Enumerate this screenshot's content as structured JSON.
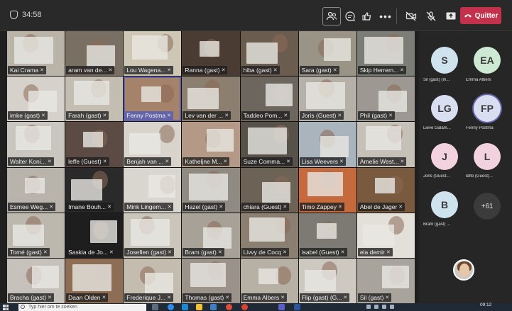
{
  "meeting": {
    "timer": "34:58",
    "leave_label": "Quitter"
  },
  "toolbar_icons": [
    "people-icon",
    "chat-icon",
    "reactions-icon",
    "more-icon",
    "camera-off-icon",
    "mic-off-icon",
    "share-icon",
    "phone-icon"
  ],
  "participants": [
    {
      "name": "Kai Crama",
      "bg": "#b9b3a8"
    },
    {
      "name": "aram van de...",
      "bg": "#7a6f63"
    },
    {
      "name": "Lou Wagena...",
      "bg": "#cfc7b6"
    },
    {
      "name": "Ranna (gast)",
      "bg": "#4a3b33"
    },
    {
      "name": "hiba (gast)",
      "bg": "#6b5c50"
    },
    {
      "name": "Sara (gast)",
      "bg": "#9a9487"
    },
    {
      "name": "Skip Herrem...",
      "bg": "#7d7d78"
    },
    {
      "name": "imke (gast)",
      "bg": "#d6d2cb"
    },
    {
      "name": "Farah (gast)",
      "bg": "#c3bdb2"
    },
    {
      "name": "Fenny Postma",
      "bg": "#a5826a",
      "active": true
    },
    {
      "name": "Lev van der ...",
      "bg": "#8c7f70"
    },
    {
      "name": "Taddeo Pom...",
      "bg": "#6c665f"
    },
    {
      "name": "Joris (Guest)",
      "bg": "#b6b1a8"
    },
    {
      "name": "Phil (gast)",
      "bg": "#9d9992"
    },
    {
      "name": "Walter Koni...",
      "bg": "#c9c6bf"
    },
    {
      "name": "leffe (Guest)",
      "bg": "#5c4a45"
    },
    {
      "name": "Benjah van ...",
      "bg": "#d8d4cc"
    },
    {
      "name": "Katheljne M...",
      "bg": "#b49a86"
    },
    {
      "name": "Suze Comma...",
      "bg": "#575249"
    },
    {
      "name": "Lisa Weevers",
      "bg": "#a9b4bd"
    },
    {
      "name": "Amelie West...",
      "bg": "#c5c1b9"
    },
    {
      "name": "Esmee Weg...",
      "bg": "#b8b3ab"
    },
    {
      "name": "Imane Bouh...",
      "bg": "#2a2a2a"
    },
    {
      "name": "Mink Lingem...",
      "bg": "#d9d6cf"
    },
    {
      "name": "Hazel (gast)",
      "bg": "#8f8a82"
    },
    {
      "name": "chiara (Guest)",
      "bg": "#6d6256"
    },
    {
      "name": "Timo Zappey",
      "bg": "#c46a3c"
    },
    {
      "name": "Abel de Jager",
      "bg": "#7a5a3e"
    },
    {
      "name": "Tomé (gast)",
      "bg": "#bdb8ae"
    },
    {
      "name": "Saskia de Jo...",
      "bg": "#1e1e1e"
    },
    {
      "name": "Josefien (gast)",
      "bg": "#cbc6bc"
    },
    {
      "name": "Bram (gast)",
      "bg": "#a7a197"
    },
    {
      "name": "Livvy de Cocq",
      "bg": "#8b7f72"
    },
    {
      "name": "isabel (Guest)",
      "bg": "#7c7a73"
    },
    {
      "name": "ela demir",
      "bg": "#e3e0da"
    },
    {
      "name": "Bracha (gast)",
      "bg": "#c6c2bb"
    },
    {
      "name": "Daan Olden",
      "bg": "#8d6e55"
    },
    {
      "name": "Frederique J...",
      "bg": "#c4bcaf"
    },
    {
      "name": "Thomas (gast)",
      "bg": "#9b938a"
    },
    {
      "name": "Emma Albers",
      "bg": "#b7b0a4"
    },
    {
      "name": "Flip (gast) (G...",
      "bg": "#cdc9c1"
    },
    {
      "name": "Sil (gast)",
      "bg": "#a8a39b"
    }
  ],
  "roster": [
    {
      "initials": "S",
      "label": "Sil (gast) (In...",
      "color": "#cfe3ee"
    },
    {
      "initials": "EA",
      "label": "Emma Albers",
      "color": "#cde9d3"
    },
    {
      "initials": "LG",
      "label": "Lieve Galam...",
      "color": "#d9def0"
    },
    {
      "initials": "FP",
      "label": "Fenny Postma",
      "color": "#d9def0",
      "active": true
    },
    {
      "initials": "J",
      "label": "Joris (Guest...",
      "color": "#f2d2de"
    },
    {
      "initials": "L",
      "label": "leffe (Guest)...",
      "color": "#f2d2de"
    },
    {
      "initials": "B",
      "label": "Bram (gast) ...",
      "color": "#cfe3ee"
    }
  ],
  "overflow_count": "+61",
  "taskbar": {
    "search_placeholder": "Typ hier om te zoeken",
    "time": "09:12"
  }
}
